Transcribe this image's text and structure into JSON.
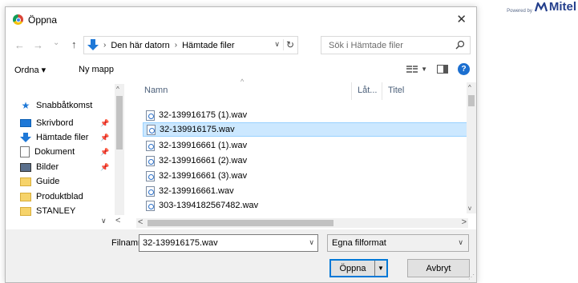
{
  "branding": {
    "powered_by": "Powered by",
    "company": "Mitel"
  },
  "dialog": {
    "title": "Öppna",
    "close": "✕"
  },
  "navbar": {
    "back": "←",
    "forward": "→",
    "recent": "⌄",
    "up": "↑",
    "breadcrumb": [
      "Den här datorn",
      "Hämtade filer"
    ],
    "search_placeholder": "Sök i Hämtade filer"
  },
  "toolbar": {
    "organize": "Ordna ▾",
    "new_folder": "Ny mapp"
  },
  "nav_pane": {
    "items": [
      {
        "label": "Snabbåtkomst",
        "icon": "star-icon"
      },
      {
        "label": "Skrivbord",
        "icon": "desktop-icon",
        "pinned": true
      },
      {
        "label": "Hämtade filer",
        "icon": "downloads-icon",
        "pinned": true
      },
      {
        "label": "Dokument",
        "icon": "document-icon",
        "pinned": true
      },
      {
        "label": "Bilder",
        "icon": "pictures-icon",
        "pinned": true
      },
      {
        "label": "Guide",
        "icon": "folder-icon"
      },
      {
        "label": "Produktblad",
        "icon": "folder-icon"
      },
      {
        "label": "STANLEY",
        "icon": "folder-icon"
      }
    ]
  },
  "file_list": {
    "columns": {
      "name": "Namn",
      "length": "Låt...",
      "title": "Titel"
    },
    "files": [
      "32-139916175 (1).wav",
      "32-139916175.wav",
      "32-139916661 (1).wav",
      "32-139916661 (2).wav",
      "32-139916661 (3).wav",
      "32-139916661.wav",
      "303-1394182567482.wav"
    ],
    "selected_index": 1
  },
  "bottom": {
    "filename_label": "Filnamn:",
    "filename_value": "32-139916175.wav",
    "filetype_value": "Egna filformat",
    "open_label": "Öppna",
    "cancel_label": "Avbryt"
  }
}
